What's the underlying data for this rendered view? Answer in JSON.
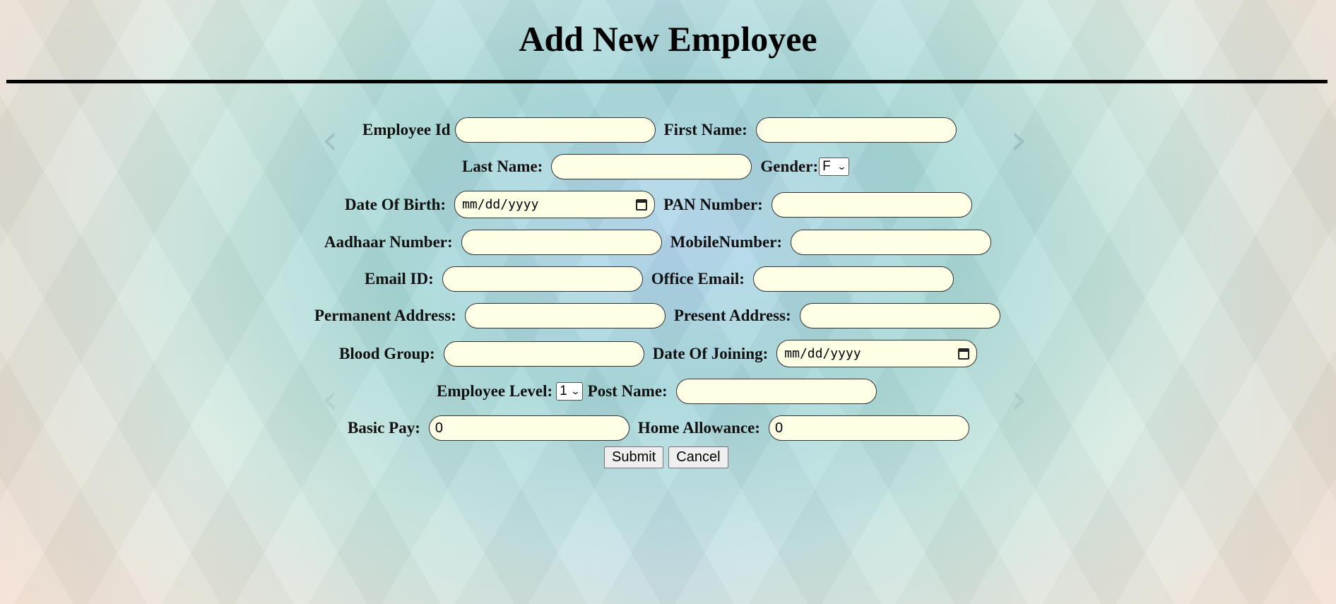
{
  "page": {
    "title": "Add New Employee"
  },
  "form": {
    "employee_id": {
      "label": "Employee Id",
      "value": ""
    },
    "first_name": {
      "label": "First Name:",
      "value": ""
    },
    "last_name": {
      "label": "Last Name:",
      "value": ""
    },
    "gender": {
      "label": "Gender:",
      "selected": "F"
    },
    "date_of_birth": {
      "label": "Date Of Birth:",
      "placeholder": "mm/dd/yyyy"
    },
    "pan_number": {
      "label": "PAN Number:",
      "value": ""
    },
    "aadhaar_number": {
      "label": "Aadhaar Number:",
      "value": ""
    },
    "mobile_number": {
      "label": "MobileNumber:",
      "value": ""
    },
    "email_id": {
      "label": "Email ID:",
      "value": ""
    },
    "office_email": {
      "label": "Office Email:",
      "value": ""
    },
    "permanent_address": {
      "label": "Permanent Address:",
      "value": ""
    },
    "present_address": {
      "label": "Present Address:",
      "value": ""
    },
    "blood_group": {
      "label": "Blood Group:",
      "value": ""
    },
    "date_of_joining": {
      "label": "Date Of Joining:",
      "placeholder": "mm/dd/yyyy"
    },
    "employee_level": {
      "label": "Employee Level:",
      "selected": "1"
    },
    "post_name": {
      "label": "Post Name:",
      "value": ""
    },
    "basic_pay": {
      "label": "Basic Pay:",
      "value": "0"
    },
    "home_allowance": {
      "label": "Home Allowance:",
      "value": "0"
    }
  },
  "buttons": {
    "submit_label": "Submit",
    "cancel_label": "Cancel"
  },
  "icons": {
    "calendar": "calendar-icon",
    "dropdown": "chevron-down-icon",
    "decor_left": "chevron-left-icon",
    "decor_right": "chevron-right-icon"
  }
}
